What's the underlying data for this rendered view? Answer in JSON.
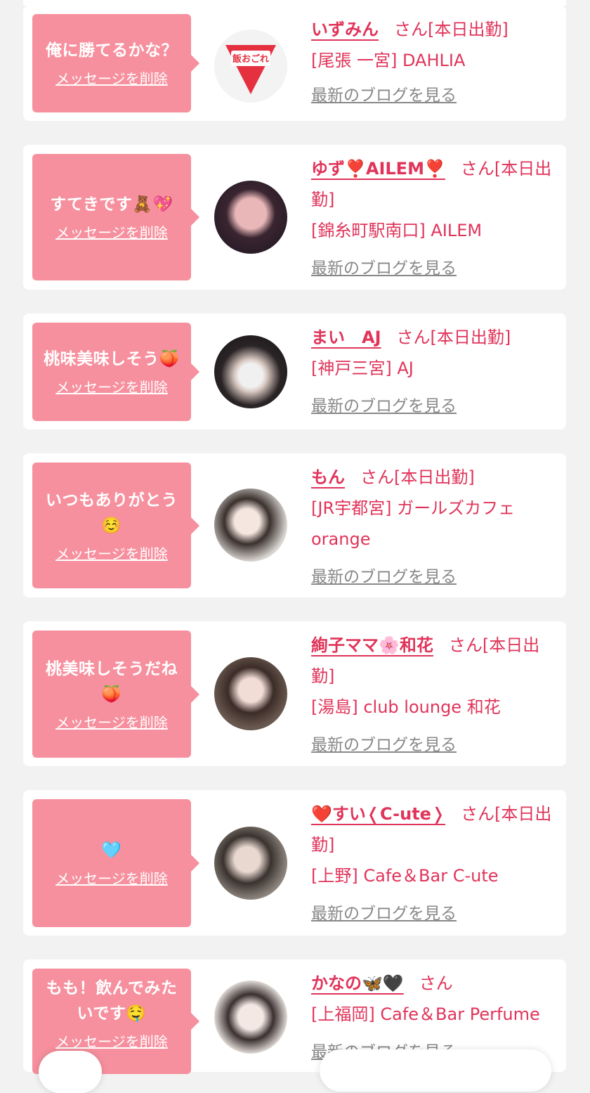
{
  "delete_label": "メッセージを削除",
  "blog_label": "最新のブログを見る",
  "san_suffix": "さん",
  "cards": [
    {
      "message": "俺に勝てるかな？",
      "name": "いずみん",
      "status": "[本日出勤]",
      "shop": "[尾張 一宮] DAHLIA"
    },
    {
      "message": "すてきです🧸💖",
      "name": "ゆず❣️AILEM❣️",
      "status": "[本日出勤]",
      "shop": "[錦糸町駅南口] AILEM"
    },
    {
      "message": "桃味美味しそう🍑",
      "name": "まい　AJ",
      "status": "[本日出勤]",
      "shop": "[神戸三宮] AJ"
    },
    {
      "message": "いつもありがとう☺️",
      "name": "もん",
      "status": "[本日出勤]",
      "shop": "[JR宇都宮] ガールズカフェorange"
    },
    {
      "message": "桃美味しそうだね🍑",
      "name": "絢子ママ🌸和花",
      "status": "[本日出勤]",
      "shop": "[湯島] club lounge 和花"
    },
    {
      "message": "🩵",
      "name": "❤️すい❬C-ute❭",
      "status": "[本日出勤]",
      "shop": "[上野] Cafe＆Bar C-ute"
    },
    {
      "message": "もも！飲んでみたいです🤤",
      "name": "かなの🦋🖤",
      "status": "",
      "shop": "[上福岡] Cafe＆Bar Perfume"
    }
  ],
  "avatar_logo_text": "飯おごれ",
  "colors": {
    "bubble": "#f7909e",
    "accent": "#e0345a",
    "link_gray": "#888888"
  }
}
